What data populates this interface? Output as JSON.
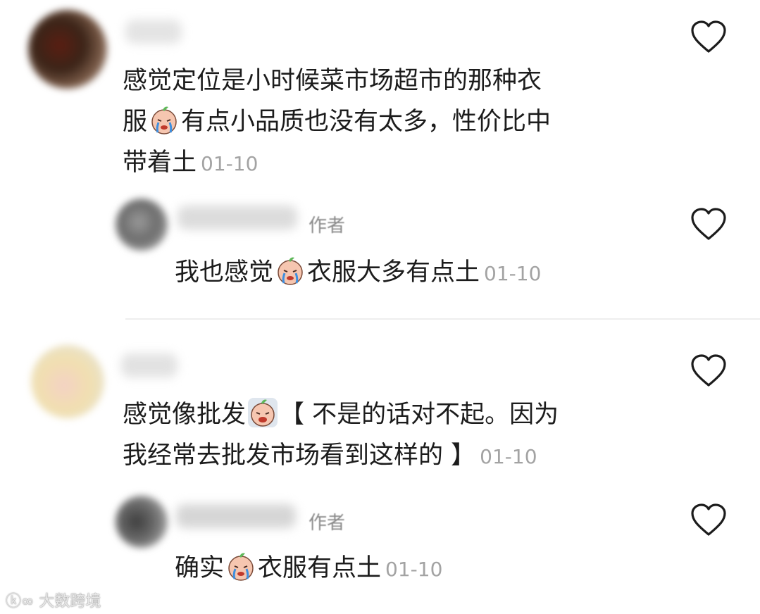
{
  "comments": [
    {
      "lines": [
        "感觉定位是小时候菜市场超市的那种衣",
        "服",
        "有点小品质也没有太多，性价比中",
        "带着土"
      ],
      "time": "01-10"
    },
    {
      "author_tag": "作者",
      "lines": [
        "我也感觉",
        "衣服大多有点土"
      ],
      "time": "01-10"
    },
    {
      "lines": [
        "感觉像批发",
        "【 不是的话对不起。因为",
        "我经常去批发市场看到这样的 】"
      ],
      "time": "01-10"
    },
    {
      "author_tag": "作者",
      "lines": [
        "确实",
        "衣服有点土"
      ],
      "time": "01-10"
    }
  ],
  "watermark": "大数跨境",
  "colors": {
    "text": "#1c1c1c",
    "time": "#a3a3a3",
    "divider": "#eeeeee",
    "like_outline": "#1c1c1c"
  },
  "icons": {
    "like": "heart-outline-icon",
    "emoji": "crying-peach-emoji"
  }
}
